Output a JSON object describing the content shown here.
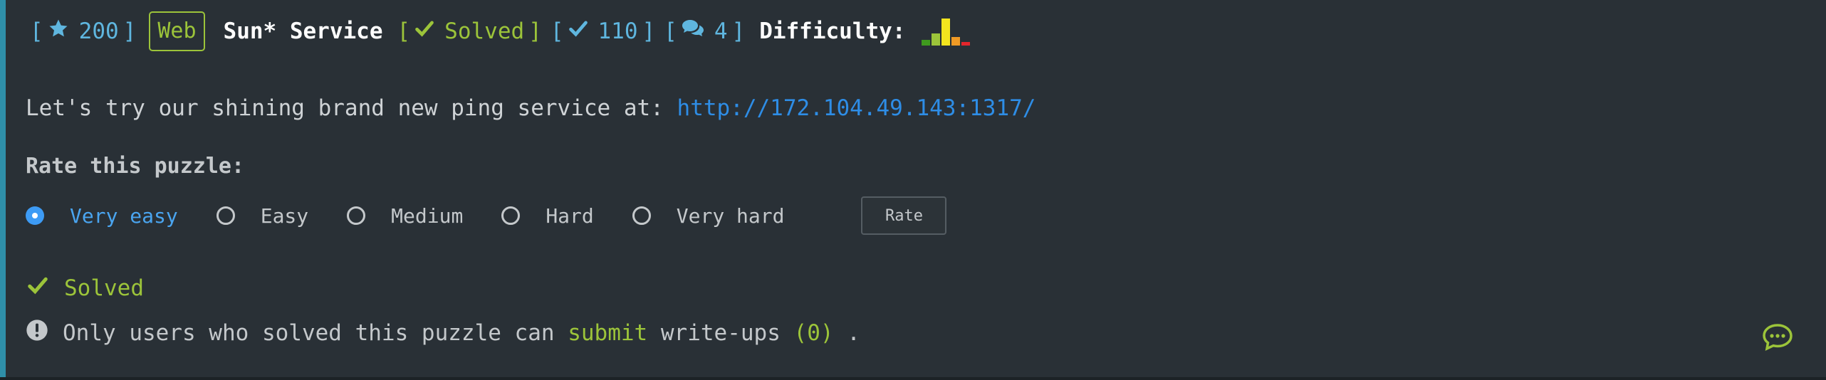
{
  "header": {
    "bracket_open": "[",
    "bracket_close": "]",
    "stars": "200",
    "tag": "Web",
    "title": "Sun* Service",
    "status": "Solved",
    "solves": "110",
    "comments": "4",
    "difficulty_label": "Difficulty:",
    "icons": {
      "stars": "star-icon",
      "status": "check-icon",
      "solves": "check-icon",
      "comments": "comments-icon"
    },
    "difficulty_bars": [
      {
        "level": 0.2,
        "color": "#3f9a1e"
      },
      {
        "level": 0.45,
        "color": "#9cc43a"
      },
      {
        "level": 1.0,
        "color": "#f3e51e"
      },
      {
        "level": 0.32,
        "color": "#f09a25"
      },
      {
        "level": 0.12,
        "color": "#e3262c"
      }
    ]
  },
  "description": {
    "text": "Let's try our shining brand new ping service at:",
    "link": "http://172.104.49.143:1317/"
  },
  "rating": {
    "title": "Rate this puzzle:",
    "options": [
      "Very easy",
      "Easy",
      "Medium",
      "Hard",
      "Very hard"
    ],
    "selected": "Very easy",
    "button": "Rate"
  },
  "solved_label": "Solved",
  "writeups": {
    "prefix": "Only users who solved this puzzle can",
    "link": "submit",
    "middle": "write-ups",
    "count": "(0)",
    "suffix": "."
  },
  "colors": {
    "accent_green": "#9cc43a",
    "accent_blue": "#5fb6df",
    "link": "#2e8de6",
    "background": "#293036"
  }
}
